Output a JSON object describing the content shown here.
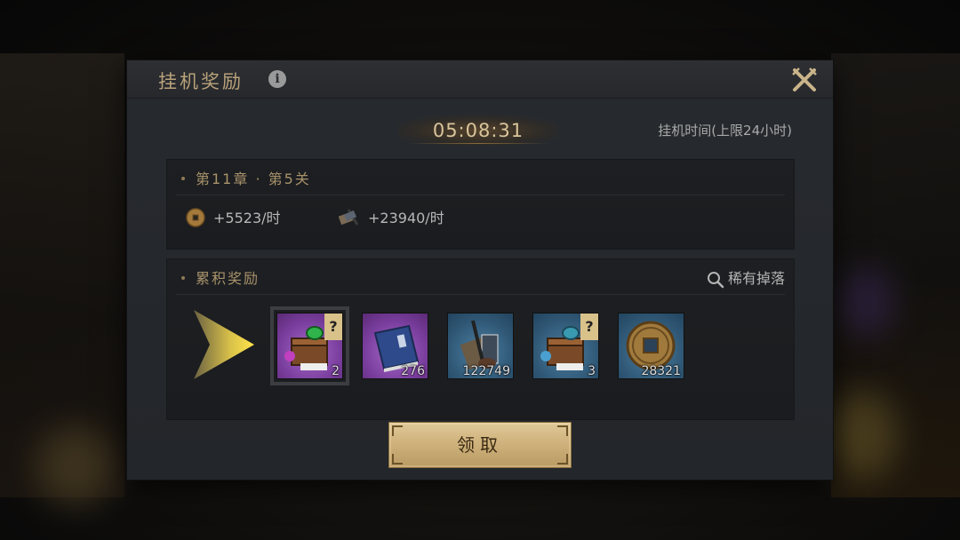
{
  "dialog": {
    "title": "挂机奖励",
    "info_icon": "info-icon",
    "close_icon": "crossed-swords-close-icon"
  },
  "timer": {
    "value": "05:08:31",
    "note": "挂机时间(上限24小时)"
  },
  "stage_panel": {
    "heading": "第11章 · 第5关",
    "coin_rate": "+5523/时",
    "exp_rate": "+23940/时"
  },
  "reward_panel": {
    "heading": "累积奖励",
    "rare_drop_label": "稀有掉落",
    "items": [
      {
        "name": "purple-mystery-chest",
        "count": "2",
        "rarity": "purple",
        "mystery": true
      },
      {
        "name": "blue-book",
        "count": "276",
        "rarity": "purple",
        "mystery": false
      },
      {
        "name": "scroll-brush-bundle",
        "count": "122749",
        "rarity": "blue",
        "mystery": false
      },
      {
        "name": "blue-mystery-chest",
        "count": "3",
        "rarity": "blue",
        "mystery": true
      },
      {
        "name": "copper-coin",
        "count": "28321",
        "rarity": "blue",
        "mystery": false
      }
    ]
  },
  "claim_button": "领取",
  "colors": {
    "gold_text": "#b8a17a",
    "button_gold": "#cdb07a",
    "purple_frame": "#7a3e9e",
    "blue_frame": "#315a78"
  }
}
